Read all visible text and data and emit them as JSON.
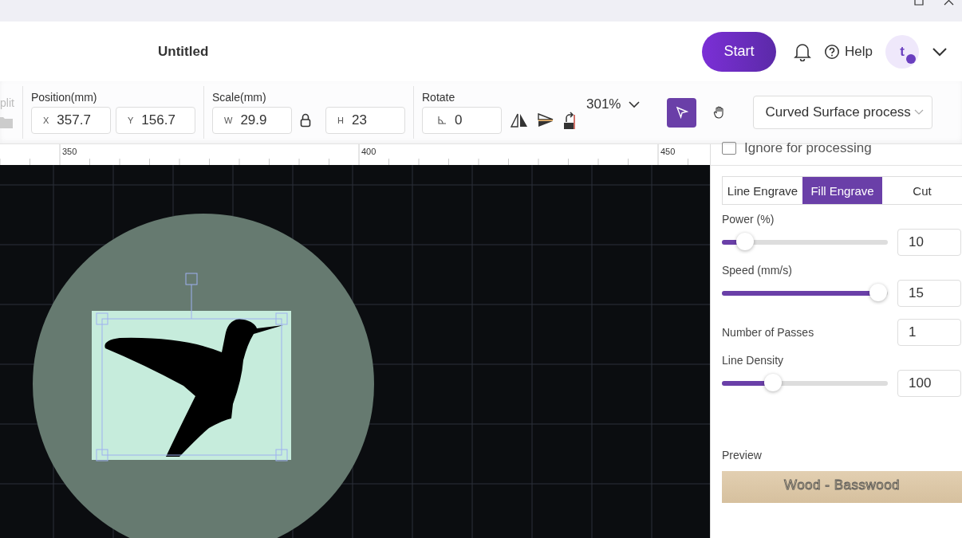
{
  "header": {
    "title": "Untitled",
    "start_button": "Start",
    "help": "Help",
    "avatar_initial": "t"
  },
  "toolbar": {
    "split_label": "plit",
    "position": {
      "label": "Position(mm)",
      "fields": [
        {
          "prefix": "X",
          "value": "357.7"
        },
        {
          "prefix": "Y",
          "value": "156.7"
        }
      ]
    },
    "scale": {
      "label": "Scale(mm)",
      "fields": [
        {
          "prefix": "W",
          "value": "29.9"
        },
        {
          "prefix": "H",
          "value": "23"
        }
      ]
    },
    "rotate": {
      "label": "Rotate",
      "value": "0"
    },
    "zoom": "301%",
    "tools": [
      {
        "kind": "select",
        "selected": true
      },
      {
        "kind": "hand",
        "selected": false
      }
    ],
    "process_dropdown": "Curved Surface process"
  },
  "ruler": {
    "labels": [
      "350",
      "400",
      "450"
    ]
  },
  "panel": {
    "ignore": {
      "label": "Ignore for processing",
      "checked": false
    },
    "tabs": [
      {
        "label": "Line Engrave",
        "selected": false
      },
      {
        "label": "Fill Engrave",
        "selected": true
      },
      {
        "label": "Cut",
        "selected": false
      }
    ],
    "settings": [
      {
        "kind": "slider",
        "label": "Power (%)",
        "level": 0.14,
        "value": "10"
      },
      {
        "kind": "slider",
        "label": "Speed (mm/s)",
        "level": 0.94,
        "value": "15"
      },
      {
        "kind": "number",
        "label": "Number of Passes",
        "value": "1"
      },
      {
        "kind": "slider",
        "label": "Line Density",
        "level": 0.31,
        "value": "100"
      }
    ],
    "preview": {
      "label": "Preview",
      "material": "Wood - Basswood"
    }
  }
}
